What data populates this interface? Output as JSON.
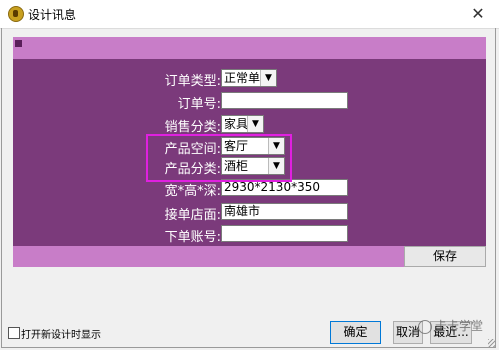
{
  "window": {
    "title": "设计讯息",
    "close_glyph": "✕"
  },
  "form": {
    "order_type_label": "订单类型:",
    "order_type_value": "正常单",
    "order_no_label": "订单号:",
    "order_no_value": "",
    "sales_category_label": "销售分类:",
    "sales_category_value": "家具",
    "product_space_label": "产品空间:",
    "product_space_value": "客厅",
    "product_category_label": "产品分类:",
    "product_category_value": "酒柜",
    "dimensions_label": "宽*高*深:",
    "dimensions_value": "2930*2130*350",
    "store_label": "接单店面:",
    "store_value": "南雄市",
    "account_label": "下单账号:",
    "account_value": ""
  },
  "buttons": {
    "save": "保存",
    "ok": "确定",
    "cancel": "取消",
    "more": "最近..."
  },
  "footer": {
    "checkbox_label": "打开新设计时显示",
    "watermark": "卡卡学堂"
  },
  "colors": {
    "panel": "#7b3a7b",
    "strip": "#c87dc8",
    "highlight": "#e020e0"
  }
}
